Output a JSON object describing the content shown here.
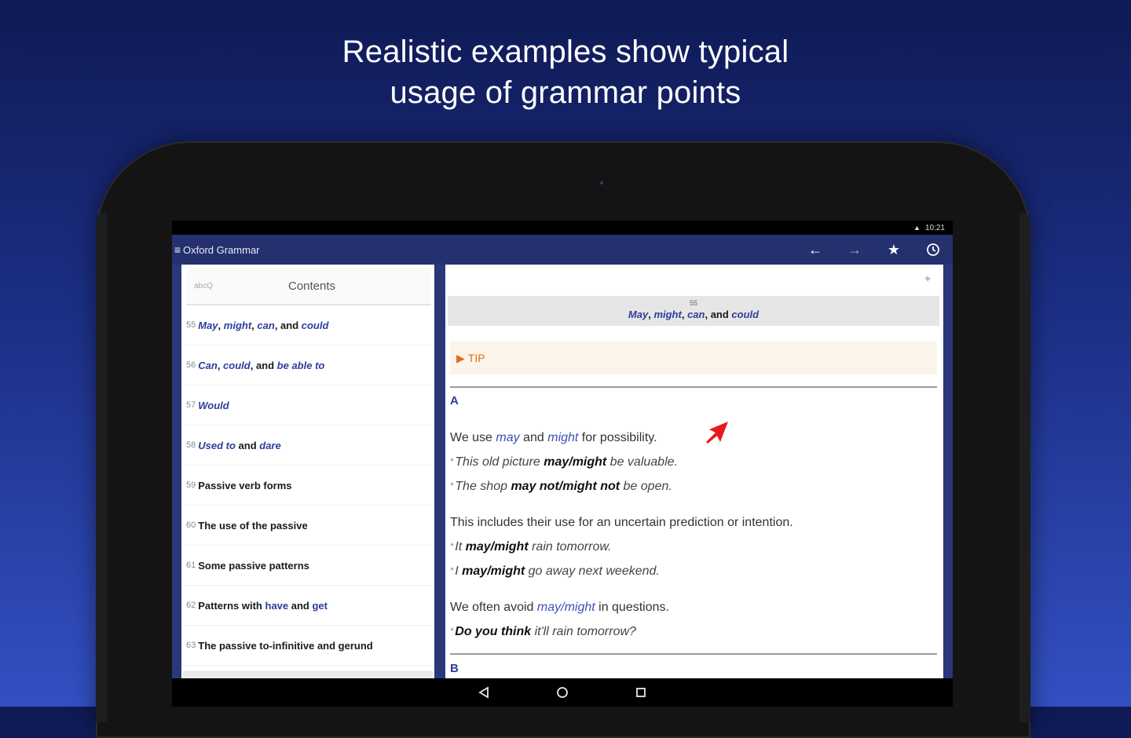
{
  "headline": {
    "line1": "Realistic examples show typical",
    "line2": "usage of grammar points"
  },
  "statusbar": {
    "time": "10:21"
  },
  "appbar": {
    "title": "Oxford Grammar",
    "actions": [
      "back-arrow-icon",
      "forward-arrow-icon",
      "star-icon",
      "history-icon"
    ]
  },
  "search": {
    "placeholder": "abcQ",
    "contents_label": "Contents"
  },
  "toc": [
    {
      "num": "55",
      "parts": [
        "May",
        ", ",
        "might",
        ", ",
        "can",
        ", and ",
        "could"
      ]
    },
    {
      "num": "56",
      "parts": [
        "Can",
        ", ",
        "could",
        ", and ",
        "be able to"
      ]
    },
    {
      "num": "57",
      "parts": [
        "Would"
      ]
    },
    {
      "num": "58",
      "parts": [
        "Used to",
        " and ",
        "dare"
      ]
    },
    {
      "num": "59",
      "title": "Passive verb forms"
    },
    {
      "num": "60",
      "title": "The use of the passive"
    },
    {
      "num": "61",
      "title": "Some passive patterns"
    },
    {
      "num": "62",
      "parts_mixed": [
        "Patterns with ",
        "have",
        " and ",
        "get"
      ]
    },
    {
      "num": "63",
      "title": "The passive to-infinitive and gerund"
    }
  ],
  "section": {
    "num": "55",
    "title_parts": [
      "May",
      ", ",
      "might",
      ", ",
      "can",
      ", and ",
      "could"
    ]
  },
  "tip": {
    "label": "TIP"
  },
  "letters": {
    "a": "A",
    "b": "B"
  },
  "content": {
    "p1": {
      "pre": "We use ",
      "kw1": "may",
      "mid": " and ",
      "kw2": "might",
      "post": " for possibility.",
      "ex1_pre": "This old picture ",
      "ex1_bold": "may/might",
      "ex1_post": " be valuable.",
      "ex2_pre": "The shop ",
      "ex2_bold": "may not/might not",
      "ex2_post": " be open."
    },
    "p2": {
      "text": "This includes their use for an uncertain prediction or intention.",
      "ex1_pre": "It ",
      "ex1_bold": "may/might",
      "ex1_post": " rain tomorrow.",
      "ex2_pre": "I ",
      "ex2_bold": "may/might",
      "ex2_post": " go away next weekend."
    },
    "p3": {
      "pre": "We often avoid ",
      "kw": "may/might",
      "post": " in questions.",
      "ex1_bold": "Do you think",
      "ex1_post": " it'll rain tomorrow?"
    }
  },
  "colors": {
    "bg_top": "#0f1a55",
    "bg_bottom": "#3250c2",
    "appbar": "#25306e",
    "accent_blue": "#2d3d9b",
    "tip_orange": "#e06b1c",
    "arrow_red": "#e8191f"
  }
}
